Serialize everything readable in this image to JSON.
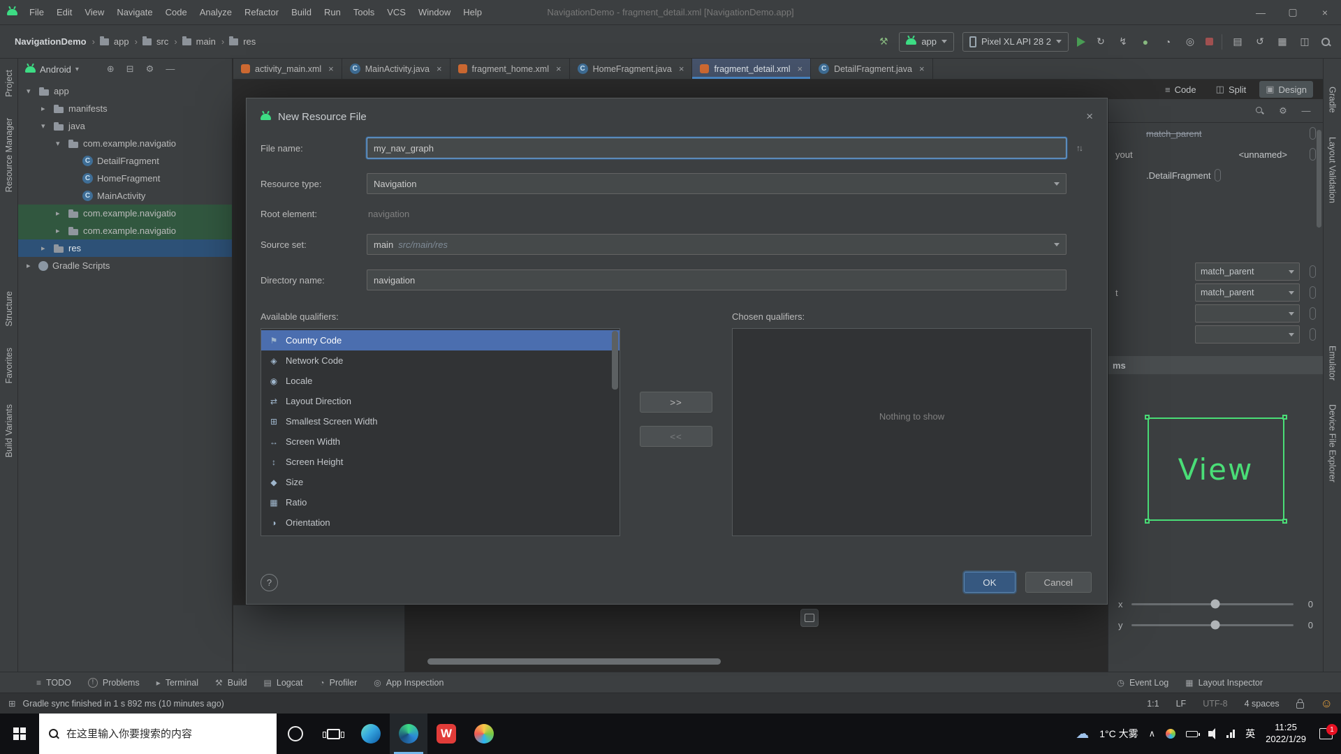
{
  "window": {
    "menus": [
      "File",
      "Edit",
      "View",
      "Navigate",
      "Code",
      "Analyze",
      "Refactor",
      "Build",
      "Run",
      "Tools",
      "VCS",
      "Window",
      "Help"
    ],
    "title": "NavigationDemo - fragment_detail.xml [NavigationDemo.app]",
    "minimize": "—",
    "maximize": "▢",
    "close": "×"
  },
  "toolbar": {
    "crumbs": [
      {
        "sep": "",
        "label": "NavigationDemo"
      },
      {
        "sep": "›",
        "label": "app"
      },
      {
        "sep": "›",
        "label": "src"
      },
      {
        "sep": "›",
        "label": "main"
      },
      {
        "sep": "›",
        "label": "res"
      }
    ],
    "build_glyph": "⚒",
    "run_config": "app",
    "device": "Pixel XL API 28 2",
    "run_actions": [
      {
        "name": "apply-changes-icon",
        "glyph": "↻",
        "color": ""
      },
      {
        "name": "apply-code-changes-icon",
        "glyph": "↯",
        "color": ""
      },
      {
        "name": "debug-icon",
        "glyph": "●",
        "color": "green"
      },
      {
        "name": "profile-icon",
        "glyph": "◔",
        "color": ""
      },
      {
        "name": "attach-debugger-icon",
        "glyph": "◎",
        "color": ""
      }
    ],
    "device_actions": [
      {
        "name": "device-manager-icon",
        "glyph": "▤"
      },
      {
        "name": "sync-project-icon",
        "glyph": "↺"
      },
      {
        "name": "layout-inspector-icon",
        "glyph": "▦"
      },
      {
        "name": "logcat-window-icon",
        "glyph": "◫"
      }
    ]
  },
  "left_stripe": [
    {
      "label": "Project"
    },
    {
      "label": "Resource Manager"
    },
    {
      "label": "Structure"
    },
    {
      "label": "Favorites"
    },
    {
      "label": "Build Variants"
    }
  ],
  "right_stripe": [
    {
      "label": "Gradle"
    },
    {
      "label": "Layout Validation"
    },
    {
      "label": "Emulator"
    },
    {
      "label": "Device File Explorer"
    }
  ],
  "project": {
    "mode": "Android",
    "chevron": "▾",
    "header_icons": [
      {
        "name": "locate-icon",
        "glyph": "⊕"
      },
      {
        "name": "collapse-all-icon",
        "glyph": "⊟"
      },
      {
        "name": "settings-icon",
        "glyph": "⚙"
      },
      {
        "name": "hide-panel-icon",
        "glyph": "—"
      }
    ],
    "tree": [
      {
        "indent": 0,
        "chevron": "▾",
        "icon": "folder",
        "label": "app",
        "state": ""
      },
      {
        "indent": 1,
        "chevron": "▸",
        "icon": "folder",
        "label": "manifests",
        "state": ""
      },
      {
        "indent": 1,
        "chevron": "▾",
        "icon": "folder",
        "label": "java",
        "state": ""
      },
      {
        "indent": 2,
        "chevron": "▾",
        "icon": "package",
        "label": "com.example.navigatio",
        "state": ""
      },
      {
        "indent": 3,
        "chevron": "",
        "icon": "class",
        "label": "DetailFragment",
        "state": ""
      },
      {
        "indent": 3,
        "chevron": "",
        "icon": "class",
        "label": "HomeFragment",
        "state": ""
      },
      {
        "indent": 3,
        "chevron": "",
        "icon": "class",
        "label": "MainActivity",
        "state": ""
      },
      {
        "indent": 2,
        "chevron": "▸",
        "icon": "package",
        "label": "com.example.navigatio",
        "state": "hl-green"
      },
      {
        "indent": 2,
        "chevron": "▸",
        "icon": "package",
        "label": "com.example.navigatio",
        "state": "hl-green"
      },
      {
        "indent": 1,
        "chevron": "▸",
        "icon": "folder",
        "label": "res",
        "state": "hl-blue"
      },
      {
        "indent": 0,
        "chevron": "▸",
        "icon": "gradle",
        "label": "Gradle Scripts",
        "state": ""
      }
    ]
  },
  "tabs": [
    {
      "icon": "android-file",
      "label": "activity_main.xml",
      "close": "×",
      "state": ""
    },
    {
      "icon": "class",
      "label": "MainActivity.java",
      "close": "×",
      "state": ""
    },
    {
      "icon": "android-file",
      "label": "fragment_home.xml",
      "close": "×",
      "state": ""
    },
    {
      "icon": "class",
      "label": "HomeFragment.java",
      "close": "×",
      "state": ""
    },
    {
      "icon": "android-file",
      "label": "fragment_detail.xml",
      "close": "×",
      "state": "active"
    },
    {
      "icon": "class",
      "label": "DetailFragment.java",
      "close": "×",
      "state": ""
    }
  ],
  "view_modes": [
    {
      "glyph": "≡",
      "label": "Code",
      "state": ""
    },
    {
      "glyph": "◫",
      "label": "Split",
      "state": ""
    },
    {
      "glyph": "▣",
      "label": "Design",
      "state": "active"
    }
  ],
  "dialog": {
    "title": "New Resource File",
    "close": "×",
    "file_name_label": "File name:",
    "file_name_value": "my_nav_graph",
    "updown_glyph": "↑↓",
    "resource_type_label": "Resource type:",
    "resource_type_value": "Navigation",
    "root_element_label": "Root element:",
    "root_element_value": "navigation",
    "source_set_label": "Source set:",
    "source_set_value": "main",
    "source_set_hint": "src/main/res",
    "directory_label": "Directory name:",
    "directory_value": "navigation",
    "available_label": "Available qualifiers:",
    "chosen_label": "Chosen qualifiers:",
    "qualifiers": [
      {
        "glyph": "⚑",
        "label": "Country Code",
        "state": "selected"
      },
      {
        "glyph": "◈",
        "label": "Network Code",
        "state": ""
      },
      {
        "glyph": "◉",
        "label": "Locale",
        "state": ""
      },
      {
        "glyph": "⇄",
        "label": "Layout Direction",
        "state": ""
      },
      {
        "glyph": "⊞",
        "label": "Smallest Screen Width",
        "state": ""
      },
      {
        "glyph": "↔",
        "label": "Screen Width",
        "state": ""
      },
      {
        "glyph": "↕",
        "label": "Screen Height",
        "state": ""
      },
      {
        "glyph": "◆",
        "label": "Size",
        "state": ""
      },
      {
        "glyph": "▦",
        "label": "Ratio",
        "state": ""
      },
      {
        "glyph": "◑",
        "label": "Orientation",
        "state": ""
      }
    ],
    "add_button": ">>",
    "remove_button": "<<",
    "empty_text": "Nothing to show",
    "help_glyph": "?",
    "ok": "OK",
    "cancel": "Cancel"
  },
  "attributes": {
    "panel_icons": [
      {
        "name": "search-icon",
        "glyph": ""
      },
      {
        "name": "settings-icon",
        "glyph": "⚙"
      },
      {
        "name": "hide-panel-icon",
        "glyph": "—"
      }
    ],
    "overridden_value": "match_parent",
    "id_partial": "yout",
    "id_value": "<unnamed>",
    "class_value": ".DetailFragment",
    "rows": [
      {
        "label": "",
        "value": "match_parent"
      },
      {
        "label": "t",
        "value": "match_parent"
      },
      {
        "label": "",
        "value": ""
      },
      {
        "label": "",
        "value": ""
      }
    ],
    "section_partial": "ms",
    "preview_label": "View",
    "sliders": [
      {
        "label": "x",
        "value": "0",
        "pos": "52%"
      },
      {
        "label": "y",
        "value": "0",
        "pos": "52%"
      }
    ]
  },
  "tool_windows": {
    "left": [
      {
        "glyph": "≡",
        "label": "TODO"
      },
      {
        "glyph": "!",
        "label": "Problems"
      },
      {
        "glyph": "▸",
        "label": "Terminal"
      },
      {
        "glyph": "⚒",
        "label": "Build"
      },
      {
        "glyph": "▤",
        "label": "Logcat"
      },
      {
        "glyph": "◔",
        "label": "Profiler"
      },
      {
        "glyph": "◎",
        "label": "App Inspection"
      }
    ],
    "right": [
      {
        "glyph": "◷",
        "label": "Event Log"
      },
      {
        "glyph": "▦",
        "label": "Layout Inspector"
      }
    ]
  },
  "status": {
    "switcher_glyph": "⊞",
    "message": "Gradle sync finished in 1 s 892 ms (10 minutes ago)",
    "caret": "1:1",
    "line_sep": "LF",
    "encoding": "UTF-8",
    "indent": "4 spaces",
    "smiley": "☺"
  },
  "taskbar": {
    "search_placeholder": "在这里输入你要搜索的内容",
    "wps_label": "W",
    "weather": "1°C 大雾",
    "caret": "∧",
    "ime": "英",
    "time": "11:25",
    "date": "2022/1/29",
    "badge": "1"
  }
}
